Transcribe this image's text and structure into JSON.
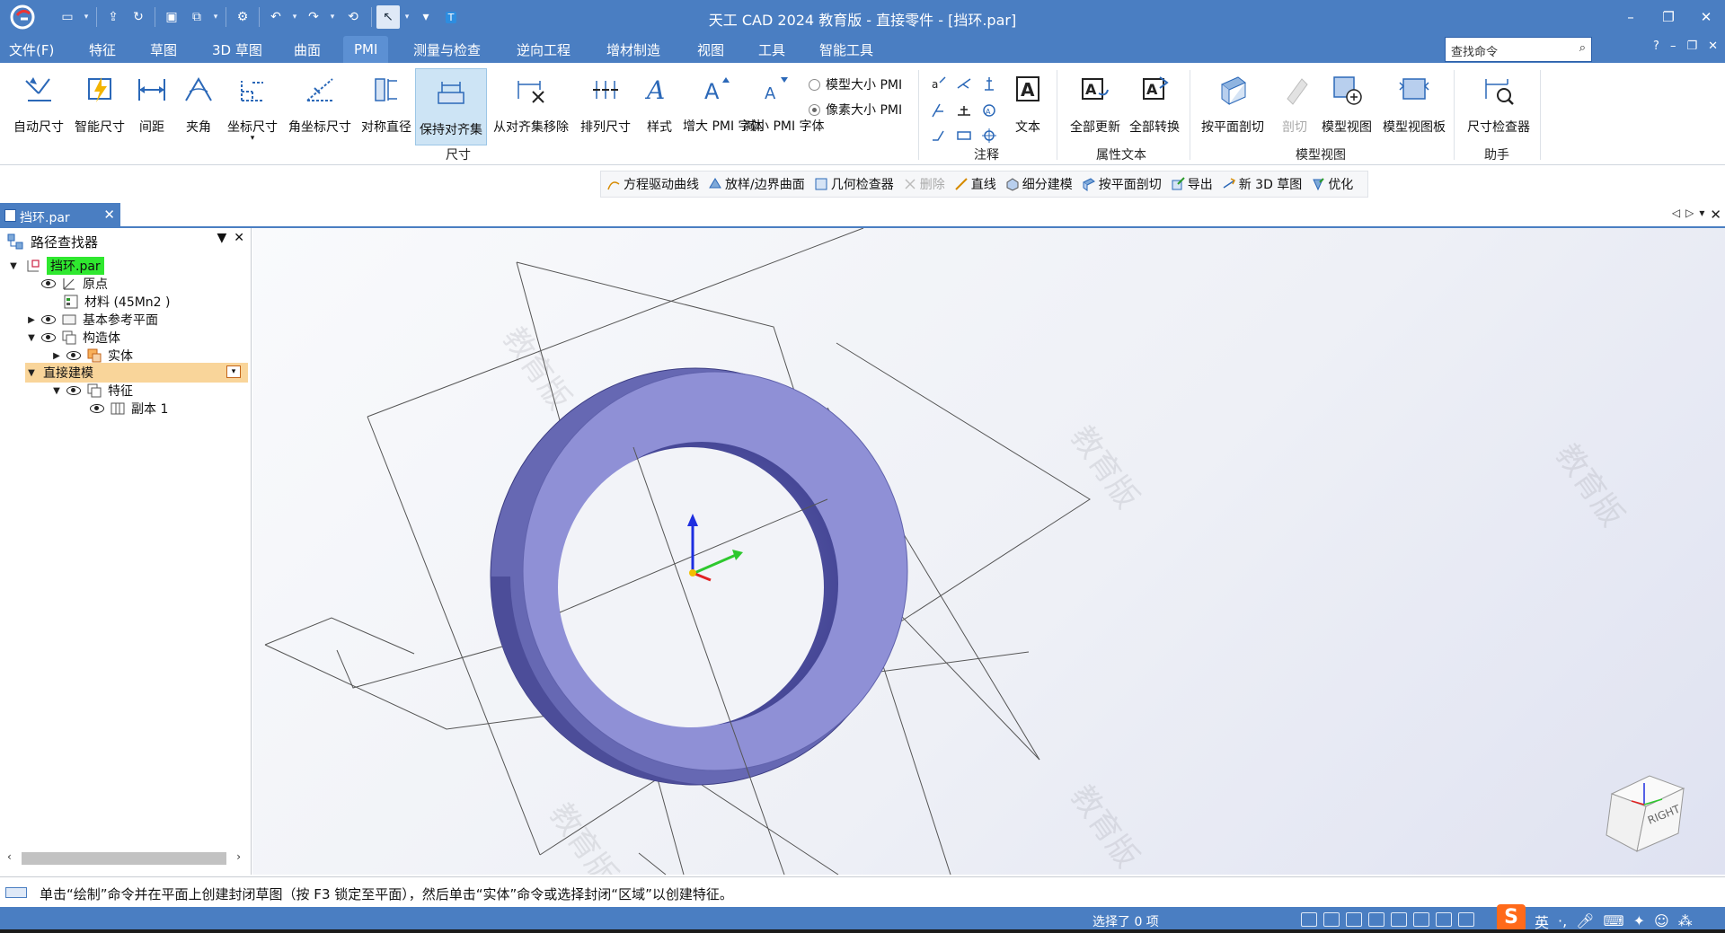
{
  "window": {
    "title": "天工 CAD 2024 教育版 - 直接零件 - [挡环.par]",
    "controls": [
      "–",
      "❐",
      "✕"
    ]
  },
  "quick_access": {
    "icons": [
      "new-icon",
      "open-icon",
      "save-icon",
      "save-all-icon",
      "settings-icon",
      "undo-icon",
      "redo-icon",
      "back-icon",
      "select-icon",
      "text-icon"
    ]
  },
  "menu": {
    "items": [
      "文件(F)",
      "特征",
      "草图",
      "3D 草图",
      "曲面",
      "PMI",
      "测量与检查",
      "逆向工程",
      "增材制造",
      "视图",
      "工具",
      "智能工具"
    ],
    "active": "PMI",
    "search_placeholder": "查找命令",
    "right_controls": [
      "?",
      "–",
      "❐",
      "✕"
    ]
  },
  "ribbon": {
    "buttons": [
      {
        "label": "自动尺寸"
      },
      {
        "label": "智能尺寸"
      },
      {
        "label": "间距"
      },
      {
        "label": "夹角"
      },
      {
        "label": "坐标尺寸"
      },
      {
        "label": "角坐标尺寸"
      },
      {
        "label": "对称直径"
      },
      {
        "label": "保持对齐集"
      },
      {
        "label": "从对齐集移除"
      },
      {
        "label": "排列尺寸"
      },
      {
        "label": "样式"
      },
      {
        "label": "增大 PMI 字体"
      },
      {
        "label": "减小 PMI 字体"
      },
      {
        "label": "文本"
      },
      {
        "label": "全部更新"
      },
      {
        "label": "全部转换"
      },
      {
        "label": "按平面剖切"
      },
      {
        "label": "剖切"
      },
      {
        "label": "模型视图"
      },
      {
        "label": "模型视图板"
      },
      {
        "label": "尺寸检查器"
      }
    ],
    "radio_options": [
      {
        "label": "模型大小 PMI",
        "selected": false
      },
      {
        "label": "像素大小 PMI",
        "selected": true
      }
    ],
    "groups": [
      "尺寸",
      "注释",
      "属性文本",
      "模型视图",
      "助手"
    ]
  },
  "command_bar": {
    "items": [
      {
        "label": "方程驱动曲线",
        "disabled": false
      },
      {
        "label": "放样/边界曲面",
        "disabled": false
      },
      {
        "label": "几何检查器",
        "disabled": false
      },
      {
        "label": "删除",
        "disabled": true
      },
      {
        "label": "直线",
        "disabled": false
      },
      {
        "label": "细分建模",
        "disabled": false
      },
      {
        "label": "按平面剖切",
        "disabled": false
      },
      {
        "label": "导出",
        "disabled": false
      },
      {
        "label": "新 3D 草图",
        "disabled": false
      },
      {
        "label": "优化",
        "disabled": false
      }
    ]
  },
  "doc_tab": {
    "label": "挡环.par"
  },
  "path_finder": {
    "title": "路径查找器",
    "tree": [
      {
        "label": "挡环.par"
      },
      {
        "label": "原点"
      },
      {
        "label": "材料 (45Mn2 )"
      },
      {
        "label": "基本参考平面"
      },
      {
        "label": "构造体"
      },
      {
        "label": "实体"
      },
      {
        "label": "直接建模"
      },
      {
        "label": "特征"
      },
      {
        "label": "副本 1"
      }
    ]
  },
  "viewport": {
    "watermark": "教育版",
    "view_cube_label": "RIGHT",
    "ring_color": "#8f90d6"
  },
  "prompt": {
    "text": "单击“绘制”命令并在平面上创建封闭草图（按 F3 锁定至平面），然后单击“实体”命令或选择封闭“区域”以创建特征。"
  },
  "status": {
    "selection": "选择了 0 项",
    "ime_lang": "英"
  },
  "colors": {
    "accent": "#4a7ec2",
    "highlight_green": "#2fe82f",
    "highlight_orange": "#f9d59a"
  }
}
